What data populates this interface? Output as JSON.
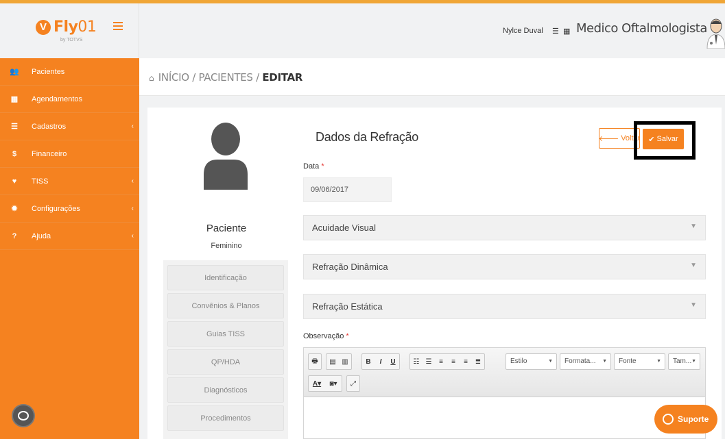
{
  "app": {
    "logo_mark": "V",
    "logo_text_bold": "Fly",
    "logo_text_light": "01",
    "logo_by": "by TOTVS"
  },
  "header": {
    "user_name": "Nylce Duval",
    "role": "Medico Oftalmologista"
  },
  "sidebar": {
    "items": [
      {
        "label": "Pacientes",
        "icon": "users-icon",
        "glyph": "👥",
        "has_submenu": false
      },
      {
        "label": "Agendamentos",
        "icon": "calendar-icon",
        "glyph": "▦",
        "has_submenu": false
      },
      {
        "label": "Cadastros",
        "icon": "list-icon",
        "glyph": "☰",
        "has_submenu": true
      },
      {
        "label": "Financeiro",
        "icon": "dollar-icon",
        "glyph": "$",
        "has_submenu": false
      },
      {
        "label": "TISS",
        "icon": "heartbeat-icon",
        "glyph": "♥",
        "has_submenu": true
      },
      {
        "label": "Configurações",
        "icon": "gear-icon",
        "glyph": "✹",
        "has_submenu": true
      },
      {
        "label": "Ajuda",
        "icon": "question-icon",
        "glyph": "?",
        "has_submenu": true
      }
    ]
  },
  "breadcrumb": {
    "home": "INÍCIO",
    "sep": " / ",
    "section": "PACIENTES",
    "current": "EDITAR"
  },
  "patient": {
    "name": "Paciente",
    "gender": "Feminino"
  },
  "side_tabs": [
    "Identificação",
    "Convênios & Planos",
    "Guias TISS",
    "QP/HDA",
    "Diagnósticos",
    "Procedimentos"
  ],
  "form": {
    "title": "Dados da Refração",
    "back_label": "Voltar",
    "save_label": "Salvar",
    "date_label": "Data",
    "required_mark": "*",
    "date_value": "09/06/2017",
    "accordions": [
      "Acuidade Visual",
      "Refração Dinâmica",
      "Refração Estática"
    ],
    "obs_label": "Observação"
  },
  "editor": {
    "style_select": "Estilo",
    "format_select": "Formata...",
    "font_select": "Fonte",
    "size_select": "Tam..."
  },
  "support": {
    "label": "Suporte"
  },
  "colors": {
    "brand": "#f58220",
    "accent_line": "#f0a636",
    "required": "#e53935"
  }
}
